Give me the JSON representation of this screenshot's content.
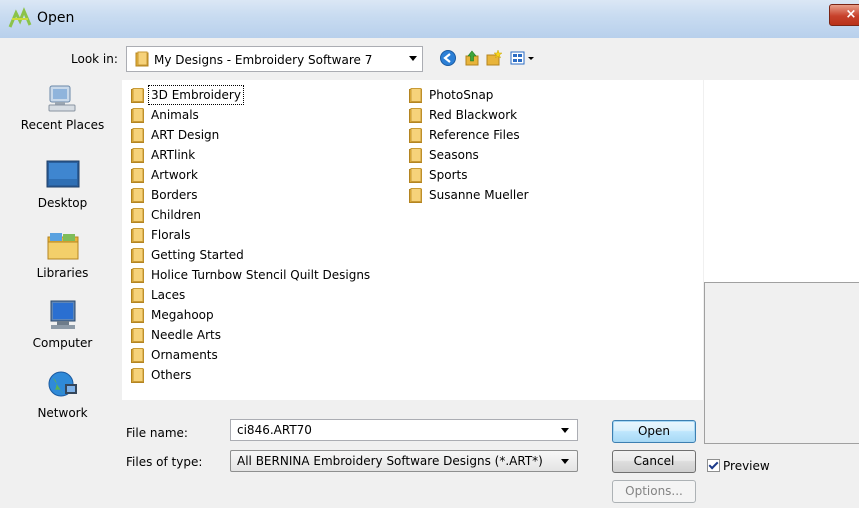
{
  "window": {
    "title": "Open",
    "close_glyph": "×"
  },
  "lookin": {
    "label": "Look in:",
    "value": "My Designs - Embroidery Software 7"
  },
  "toolbar_icons": [
    "back-icon",
    "up-folder-icon",
    "new-folder-icon",
    "view-menu-icon"
  ],
  "places": [
    {
      "name": "Recent Places",
      "icon": "recent-places-icon"
    },
    {
      "name": "Desktop",
      "icon": "desktop-icon"
    },
    {
      "name": "Libraries",
      "icon": "libraries-icon"
    },
    {
      "name": "Computer",
      "icon": "computer-icon"
    },
    {
      "name": "Network",
      "icon": "network-icon"
    }
  ],
  "folders_col1": [
    "3D Embroidery",
    "Animals",
    "ART Design",
    "ARTlink",
    "Artwork",
    "Borders",
    "Children",
    "Florals",
    "Getting Started",
    "Holice Turnbow Stencil Quilt Designs",
    "Laces",
    "Megahoop",
    "Needle Arts",
    "Ornaments",
    "Others"
  ],
  "folders_col2": [
    "PhotoSnap",
    "Red Blackwork",
    "Reference Files",
    "Seasons",
    "Sports",
    "Susanne Mueller"
  ],
  "selected_folder": "3D Embroidery",
  "filename": {
    "label": "File name:",
    "value": "ci846.ART70"
  },
  "filetype": {
    "label": "Files of type:",
    "value": "All BERNINA Embroidery Software Designs (*.ART*)"
  },
  "buttons": {
    "open": "Open",
    "cancel": "Cancel",
    "options": "Options..."
  },
  "preview": {
    "label": "Preview",
    "checked": true
  },
  "colors": {
    "folder": "#e8b43a",
    "titlebar": "#c9dcf1",
    "close": "#c7412b"
  }
}
